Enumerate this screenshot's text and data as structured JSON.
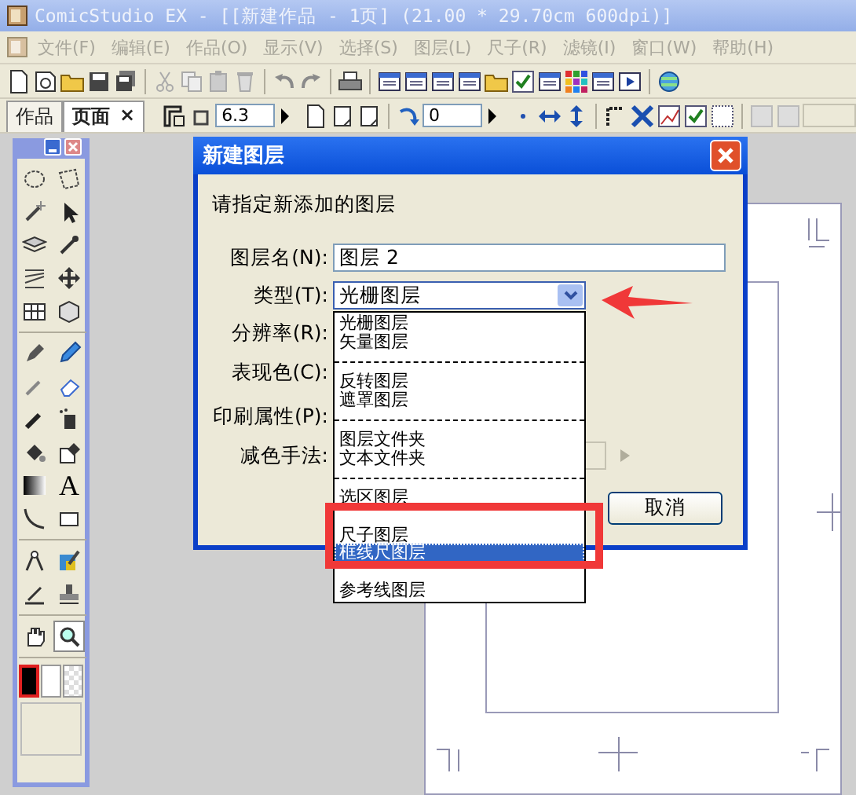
{
  "window": {
    "title": "ComicStudio EX - [[新建作品 - 1页] (21.00 * 29.70cm 600dpi)]"
  },
  "menu_bar": [
    {
      "label": "文件(F)",
      "disabled": true
    },
    {
      "label": "编辑(E)",
      "disabled": true
    },
    {
      "label": "作品(O)",
      "disabled": true
    },
    {
      "label": "显示(V)",
      "disabled": true
    },
    {
      "label": "选择(S)",
      "disabled": true
    },
    {
      "label": "图层(L)",
      "disabled": true
    },
    {
      "label": "尺子(R)",
      "disabled": true
    },
    {
      "label": "滤镜(I)",
      "disabled": true
    },
    {
      "label": "窗口(W)",
      "disabled": true
    },
    {
      "label": "帮助(H)",
      "disabled": true
    }
  ],
  "document_tabs": [
    {
      "label": "作品",
      "selected": false
    },
    {
      "label": "页面",
      "selected": true,
      "close": "×"
    }
  ],
  "tool_options": {
    "fields": [
      "6.3",
      "0"
    ]
  },
  "tool_palette": {
    "tools": [
      {
        "selected": false
      },
      {
        "selected": false
      },
      {
        "selected": false
      },
      {
        "selected": false
      },
      {
        "selected": false
      },
      {
        "selected": false
      },
      {
        "selected": false
      },
      {
        "selected": false
      },
      {
        "selected": false
      },
      {
        "selected": false
      },
      {
        "selected": false
      },
      {
        "selected": false
      },
      {
        "selected": false
      },
      {
        "selected": false
      },
      {
        "selected": false
      },
      {
        "selected": false
      },
      {
        "selected": false
      },
      {
        "selected": false
      },
      {
        "selected": false
      },
      {
        "selected": false,
        "glyph": "A"
      },
      {
        "selected": false
      },
      {
        "selected": false
      },
      {
        "selected": false
      },
      {
        "selected": false
      },
      {
        "selected": false
      },
      {
        "selected": false
      },
      {
        "selected": false
      },
      {
        "selected": true
      }
    ],
    "swatches": [
      {
        "kind": "solid",
        "color": "#000000",
        "selected": true
      },
      {
        "kind": "solid",
        "color": "#ffffff",
        "selected": false
      },
      {
        "kind": "transparent",
        "selected": false
      }
    ]
  },
  "dialog": {
    "title": "新建图层",
    "prompt": "请指定新添加的图层",
    "rows": [
      {
        "label": "图层名(N):",
        "kind": "text",
        "value": "图层 2"
      },
      {
        "label": "类型(T):",
        "kind": "dropdown",
        "value": "光栅图层",
        "expanded": true
      },
      {
        "label": "分辨率(R):",
        "kind": "covered"
      },
      {
        "label": "表现色(C):",
        "kind": "covered"
      },
      {
        "label": "印刷属性(P):",
        "kind": "covered"
      },
      {
        "label": "减色手法:",
        "kind": "disabled_field"
      }
    ],
    "buttons": [
      {
        "label": "取消"
      }
    ],
    "dropdown_options": [
      {
        "kind": "option",
        "label": "光栅图层",
        "selected": false
      },
      {
        "kind": "option",
        "label": "矢量图层",
        "selected": false
      },
      {
        "kind": "separator"
      },
      {
        "kind": "option",
        "label": "反转图层",
        "selected": false
      },
      {
        "kind": "option",
        "label": "遮罩图层",
        "selected": false
      },
      {
        "kind": "separator"
      },
      {
        "kind": "option",
        "label": "图层文件夹",
        "selected": false
      },
      {
        "kind": "option",
        "label": "文本文件夹",
        "selected": false
      },
      {
        "kind": "separator"
      },
      {
        "kind": "option",
        "label": "选区图层",
        "selected": false
      },
      {
        "kind": "gap"
      },
      {
        "kind": "option",
        "label": "尺子图层",
        "selected": false
      },
      {
        "kind": "option",
        "label": "框线尺图层",
        "selected": true
      },
      {
        "kind": "gap"
      },
      {
        "kind": "option",
        "label": "参考线图层",
        "selected": false
      }
    ]
  },
  "annotations": {
    "highlight_frame": true,
    "pointer_arrow": true
  }
}
